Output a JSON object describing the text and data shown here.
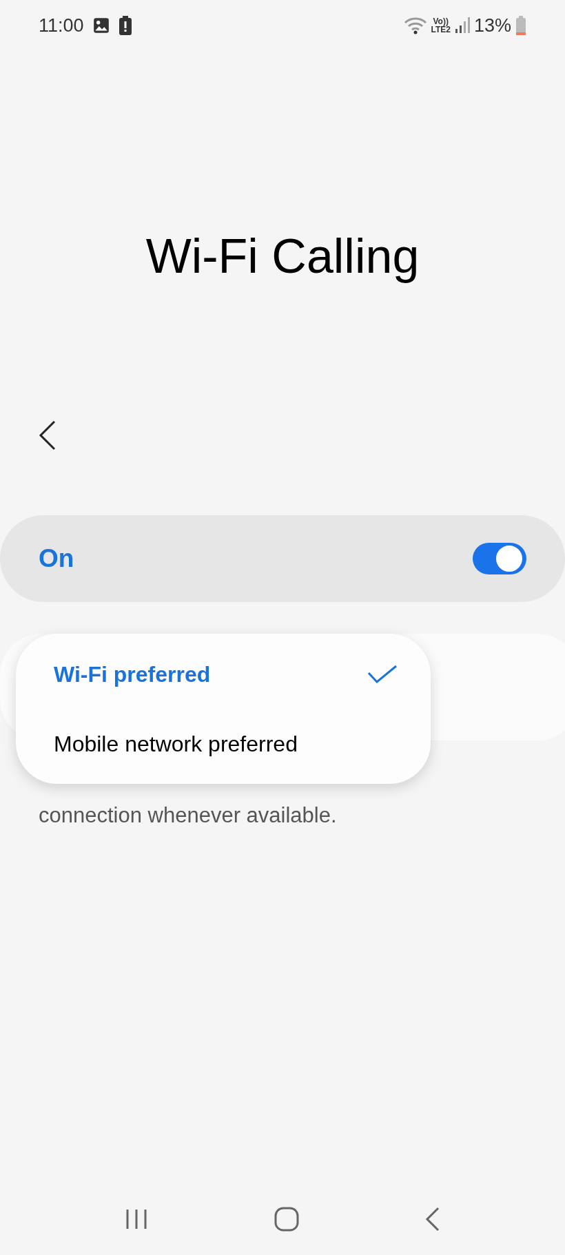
{
  "status_bar": {
    "time": "11:00",
    "network": "LTE2",
    "volte": "Vo))",
    "battery": "13%"
  },
  "title": "Wi-Fi Calling",
  "master_switch": {
    "label": "On",
    "on": true
  },
  "preference_menu": {
    "options": [
      {
        "label": "Wi-Fi preferred",
        "selected": true
      },
      {
        "label": "Mobile network preferred",
        "selected": false
      }
    ]
  },
  "description": "connection whenever available."
}
